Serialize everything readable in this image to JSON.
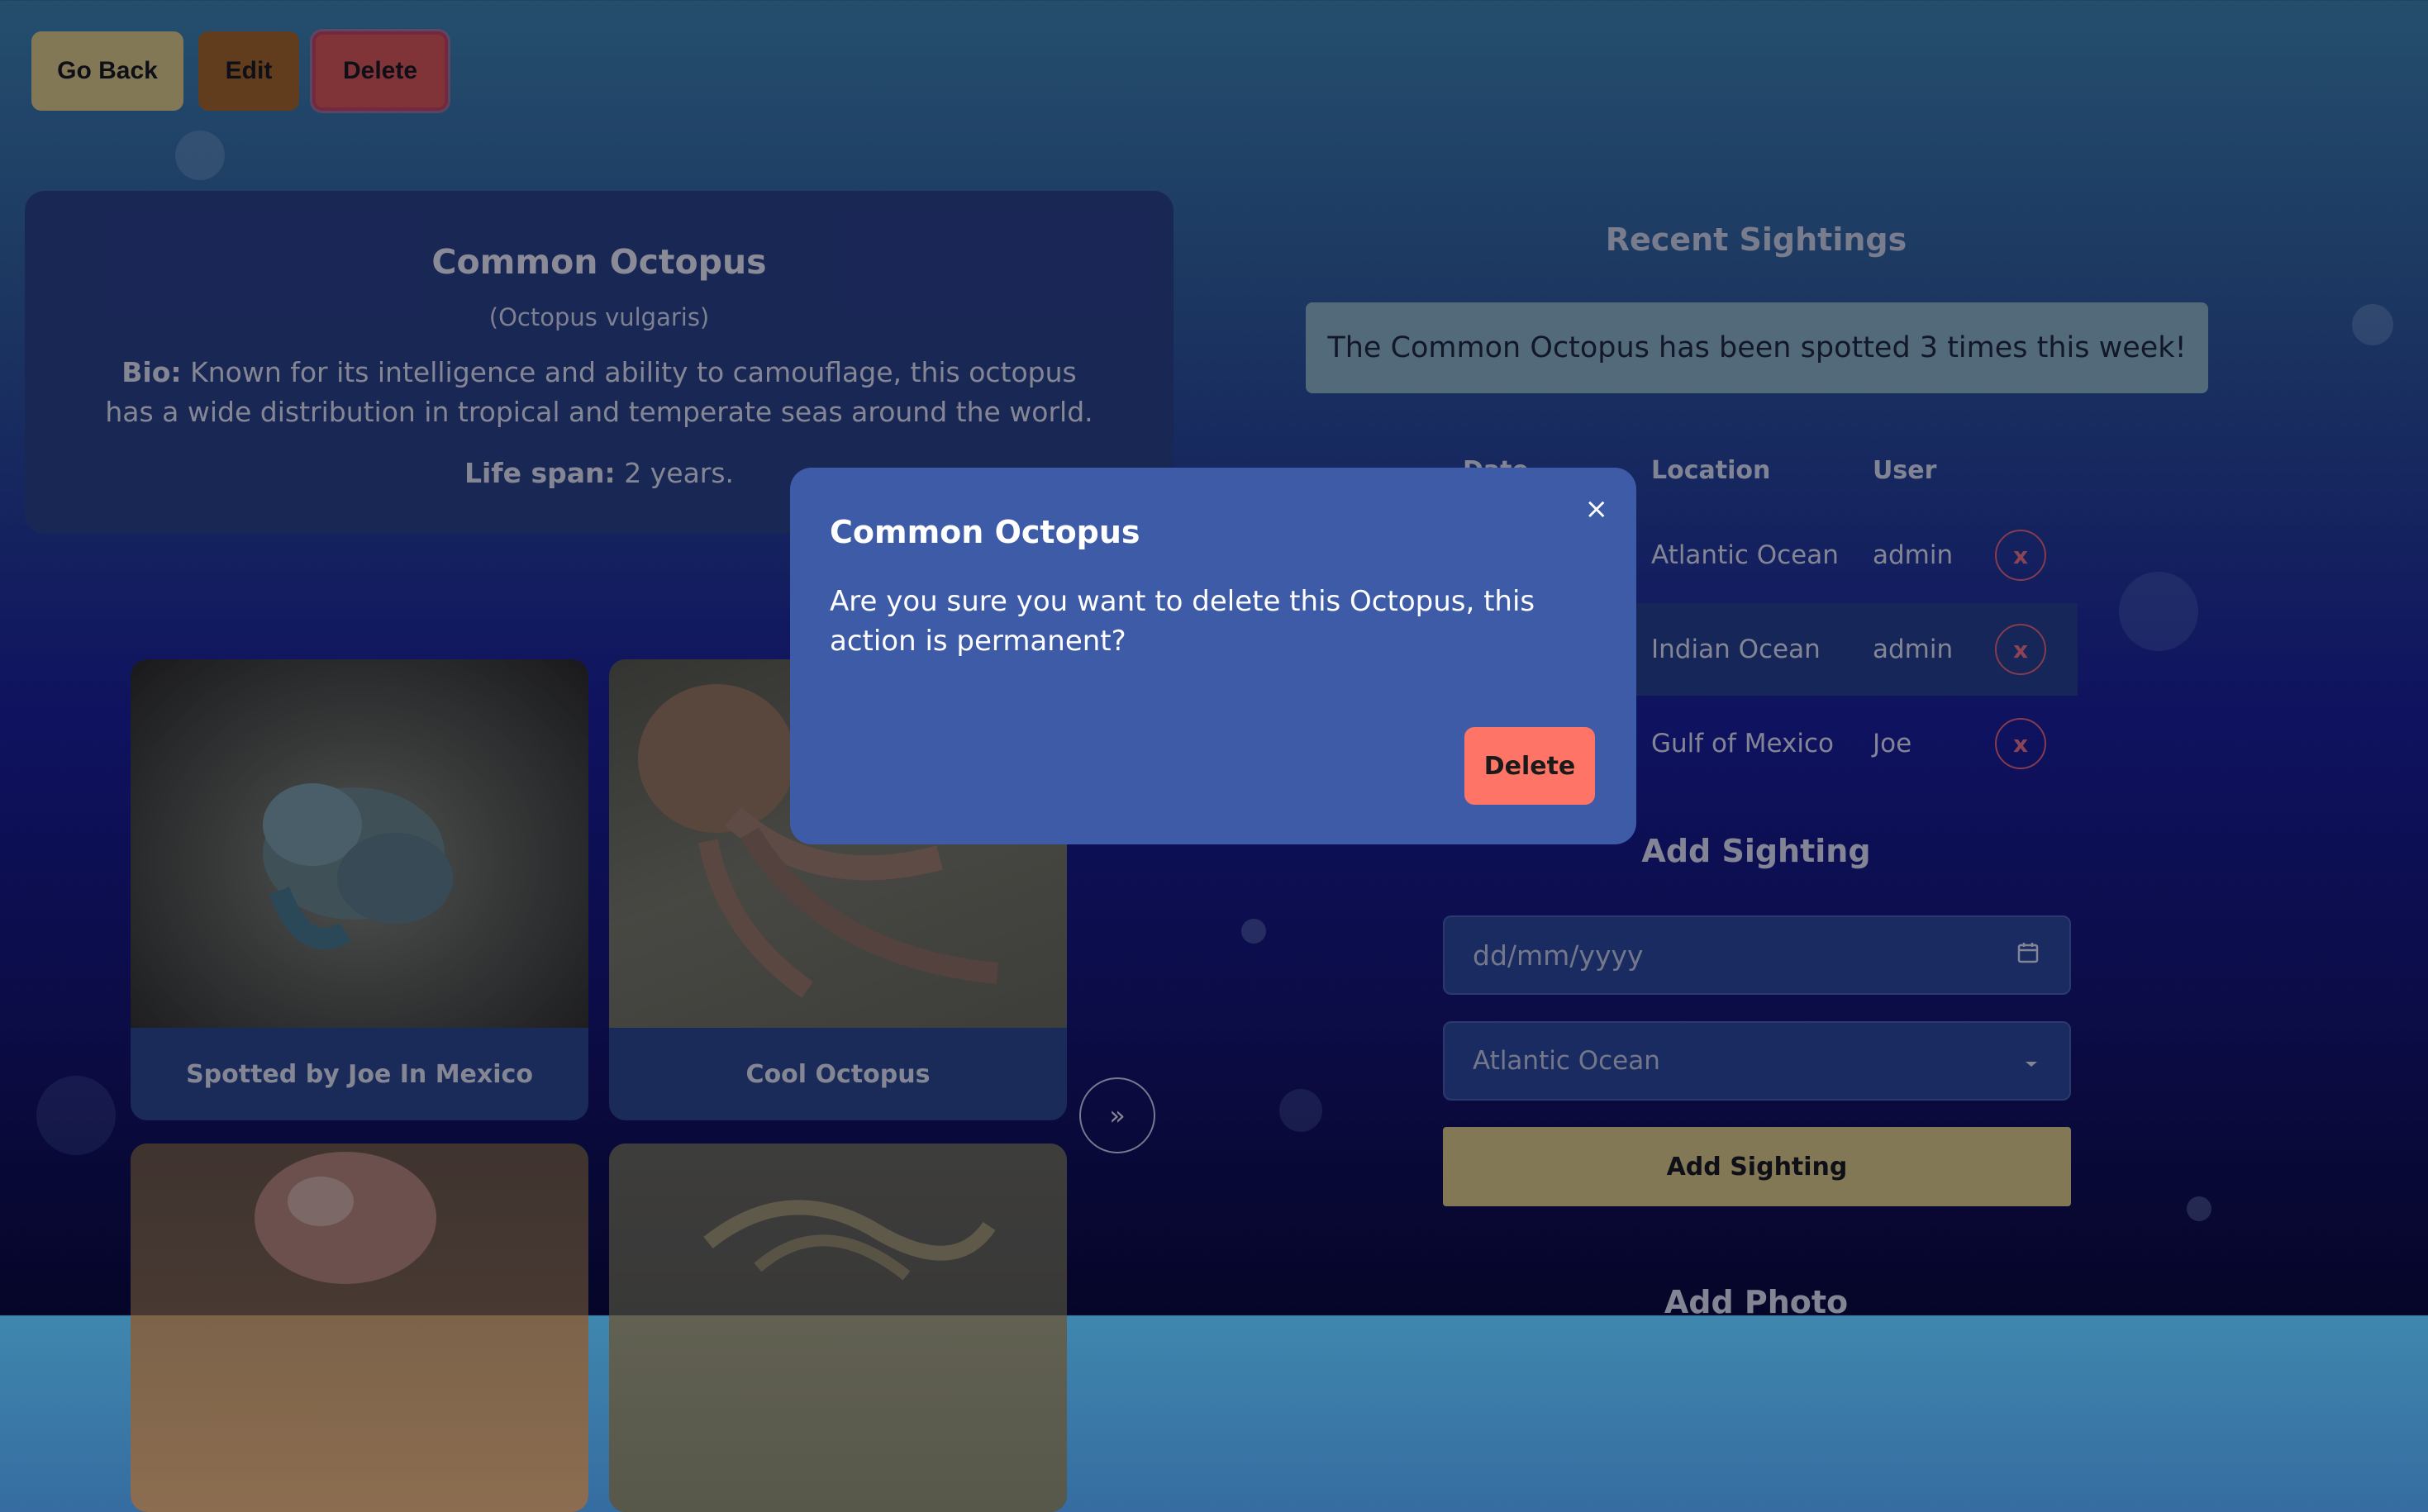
{
  "toolbar": {
    "go_back": "Go Back",
    "edit": "Edit",
    "delete": "Delete"
  },
  "species": {
    "name": "Common Octopus",
    "scientific": "(Octopus vulgaris)",
    "bio_label": "Bio:",
    "bio": "Known for its intelligence and ability to camouflage, this octopus has a wide distribution in tropical and temperate seas around the world.",
    "lifespan_label": "Life span:",
    "lifespan": "2 years."
  },
  "photos": [
    {
      "caption": "Spotted by Joe In Mexico"
    },
    {
      "caption": "Cool Octopus"
    },
    {
      "caption": ""
    },
    {
      "caption": ""
    }
  ],
  "next_icon": "»",
  "sightings": {
    "title": "Recent Sightings",
    "banner": "The Common Octopus has been spotted 3 times this week!",
    "headers": [
      "Date",
      "Location",
      "User"
    ],
    "rows": [
      {
        "location": "Atlantic Ocean",
        "user": "admin",
        "remove": "x"
      },
      {
        "location": "Indian Ocean",
        "user": "admin",
        "remove": "x"
      },
      {
        "location": "Gulf of Mexico",
        "user": "Joe",
        "remove": "x"
      }
    ]
  },
  "add_sighting": {
    "title": "Add Sighting",
    "date_placeholder": "dd/mm/yyyy",
    "location_selected": "Atlantic Ocean",
    "button": "Add Sighting"
  },
  "add_photo": {
    "title": "Add Photo"
  },
  "modal": {
    "title": "Common Octopus",
    "close": "×",
    "message": "Are you sure you want to delete this Octopus, this action is permanent?",
    "delete": "Delete"
  },
  "icons": {
    "calendar": "calendar-icon",
    "dropdown": "chevron-down-icon",
    "close": "close-icon"
  }
}
